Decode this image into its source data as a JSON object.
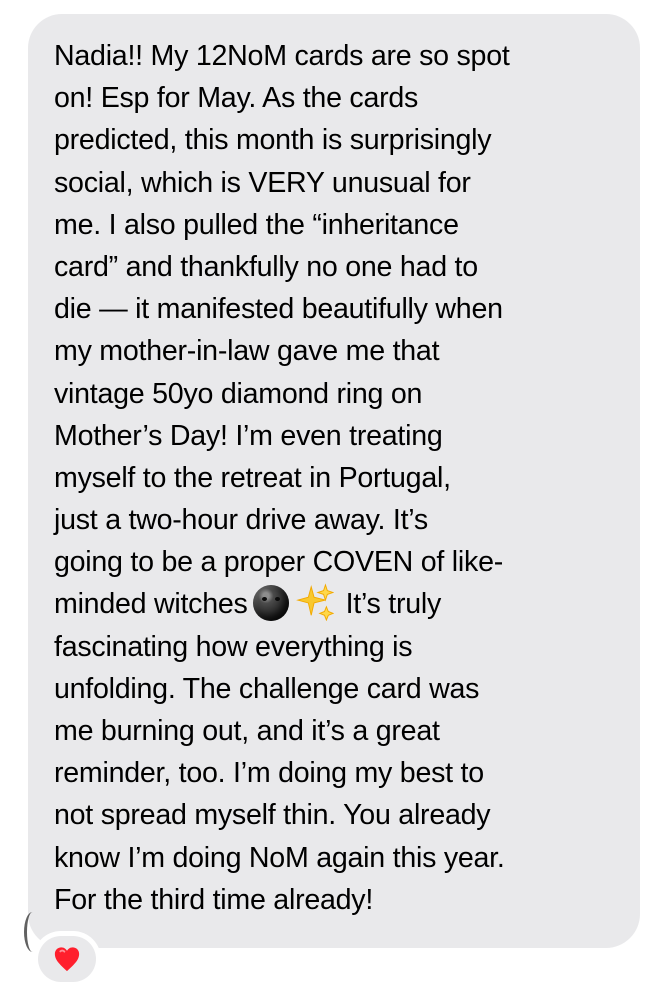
{
  "message": {
    "lines": [
      "Nadia!! My 12NoM cards are so spot",
      "on! Esp for May. As the cards",
      "predicted, this month is surprisingly",
      "social, which is VERY unusual for",
      "me. I also pulled the “inheritance",
      "card” and thankfully no one had to",
      "die — it manifested beautifully when",
      "my mother-in-law gave me that",
      "vintage 50yo diamond ring on",
      "Mother’s Day! I’m even treating",
      "myself to the retreat in Portugal,",
      "just a two-hour drive away. It’s",
      "going to be a proper COVEN of like-",
      "minded witches",
      "It’s truly",
      "fascinating how everything is",
      "unfolding. The challenge card was",
      "me burning out, and it’s a great",
      "reminder, too. I’m doing my best to",
      "not spread myself thin. You already",
      "know I’m doing NoM again this year.",
      "For the third time already!"
    ],
    "emojis": {
      "moon": "new-moon-face-icon",
      "sparkles": "sparkles-icon"
    }
  },
  "reaction": {
    "icon": "red-heart-icon",
    "color": "#ff1f2d"
  },
  "colors": {
    "background": "#ffffff",
    "bubble": "#e9e9eb",
    "text": "#000000"
  }
}
